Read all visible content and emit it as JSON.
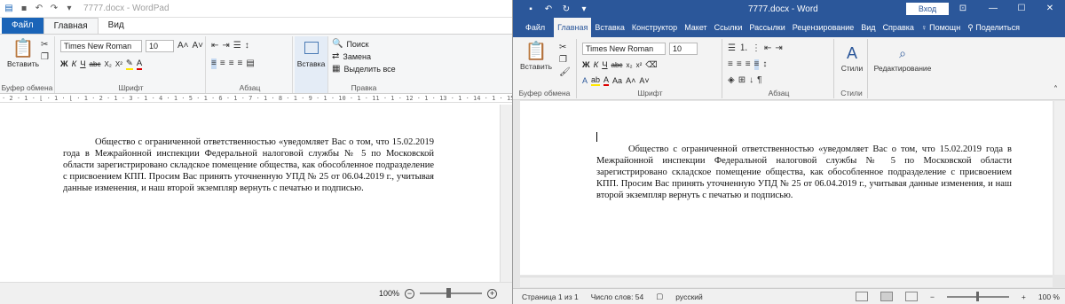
{
  "wordpad": {
    "title": "7777.docx - WordPad",
    "tabs": [
      "Файл",
      "Главная",
      "Вид"
    ],
    "ribbon": {
      "paste_label": "Вставить",
      "clipboard_group": "Буфер обмена",
      "font_name": "Times New Roman",
      "font_size": "10",
      "font_group": "Шрифт",
      "paragraph_group": "Абзац",
      "insert_label": "Вставка",
      "find_label": "Поиск",
      "replace_label": "Замена",
      "select_all_label": "Выделить все",
      "editing_group": "Правка"
    },
    "ruler": "· 2 · 1 · ⌊ · 1 · ⌊ · 1 · 2 · 1 · 3 · 1 · 4 · 1 · 5 · 1 · 6 · 1 · 7 · 1 · 8 · 1 · 9 · 1 · 10 · 1 · 11 · 1 · 12 · 1 · 13 · 1 · 14 · 1 · 15 · 1 · 16 · 1 · 17 ·",
    "document_text": "Общество с ограниченной ответственностью «уведомляет Вас о том, что 15.02.2019 года в Межрайонной инспекции Федеральной налоговой службы № 5 по Московской области зарегистрировано складское помещение общества, как обособленное подразделение с присвоением КПП. Просим Вас принять уточненную УПД № 25 от 06.04.2019 г., учитывая данные изменения, и наш второй экземпляр вернуть с печатью и подписью.",
    "zoom": "100%"
  },
  "word": {
    "title": "7777.docx - Word",
    "login": "Вход",
    "tabs": [
      "Файл",
      "Главная",
      "Вставка",
      "Конструктор",
      "Макет",
      "Ссылки",
      "Рассылки",
      "Рецензирование",
      "Вид",
      "Справка"
    ],
    "help": "Помощн",
    "share": "Поделиться",
    "ribbon": {
      "paste_label": "Вставить",
      "clipboard_group": "Буфер обмена",
      "font_name": "Times New Roman",
      "font_size": "10",
      "font_group": "Шрифт",
      "paragraph_group": "Абзац",
      "styles_label": "Стили",
      "styles_group": "Стили",
      "editing_label": "Редактирование"
    },
    "document_text": "Общество с ограниченной ответственностью «уведомляет Вас о том, что 15.02.2019 года в Межрайонной инспекции Федеральной налоговой службы № 5 по Московской области зарегистрировано складское помещение общества, как обособленное подразделение с присвоением КПП. Просим Вас принять уточненную УПД № 25 от 06.04.2019 г., учитывая данные изменения, и наш второй экземпляр вернуть с печатью и подписью.",
    "status": {
      "page": "Страница 1 из 1",
      "words": "Число слов: 54",
      "language": "русский",
      "zoom": "100 %"
    }
  }
}
